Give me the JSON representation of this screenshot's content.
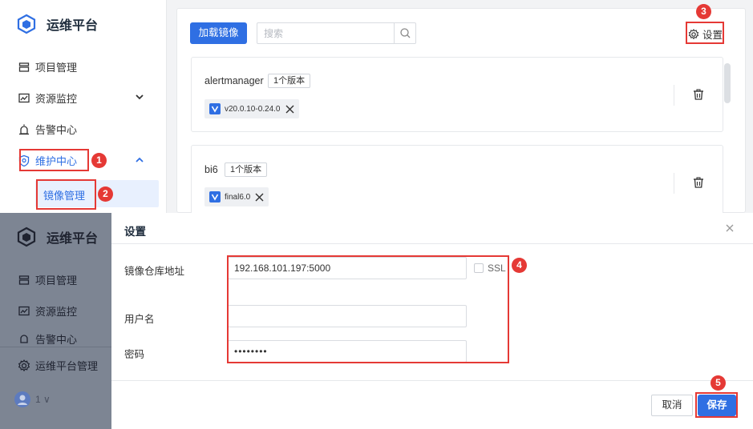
{
  "app": {
    "title": "运维平台"
  },
  "sidebar": {
    "items": [
      {
        "label": "项目管理",
        "icon": "layers-icon"
      },
      {
        "label": "资源监控",
        "icon": "monitor-chart-icon"
      },
      {
        "label": "告警中心",
        "icon": "alarm-icon"
      },
      {
        "label": "维护中心",
        "icon": "shield-maintenance-icon"
      }
    ],
    "sub_items": [
      {
        "label": "镜像管理"
      }
    ],
    "bottom_item": {
      "label": "运维平台管理",
      "icon": "gear-icon"
    },
    "user": {
      "text": "1 ∨"
    }
  },
  "toolbar": {
    "load_button": "加载镜像",
    "search_placeholder": "搜索",
    "settings_label": "设置"
  },
  "images": [
    {
      "name": "alertmanager",
      "version_count": "1个版本",
      "tags": [
        "v20.0.10-0.24.0"
      ]
    },
    {
      "name": "bi6",
      "version_count": "1个版本",
      "tags": [
        "final6.0"
      ]
    }
  ],
  "dialog": {
    "title": "设置",
    "fields": {
      "registry_label": "镜像仓库地址",
      "registry_value": "192.168.101.197:5000",
      "ssl_label": "SSL",
      "ssl_checked": false,
      "username_label": "用户名",
      "username_value": "",
      "password_label": "密码",
      "password_value": "••••••••"
    },
    "cancel_button": "取消",
    "save_button": "保存"
  },
  "annotations": [
    "1",
    "2",
    "3",
    "4",
    "5"
  ],
  "colors": {
    "primary": "#2f6fe3",
    "annotation_red": "#e53935",
    "overlay_sidebar": "#7d8593"
  }
}
